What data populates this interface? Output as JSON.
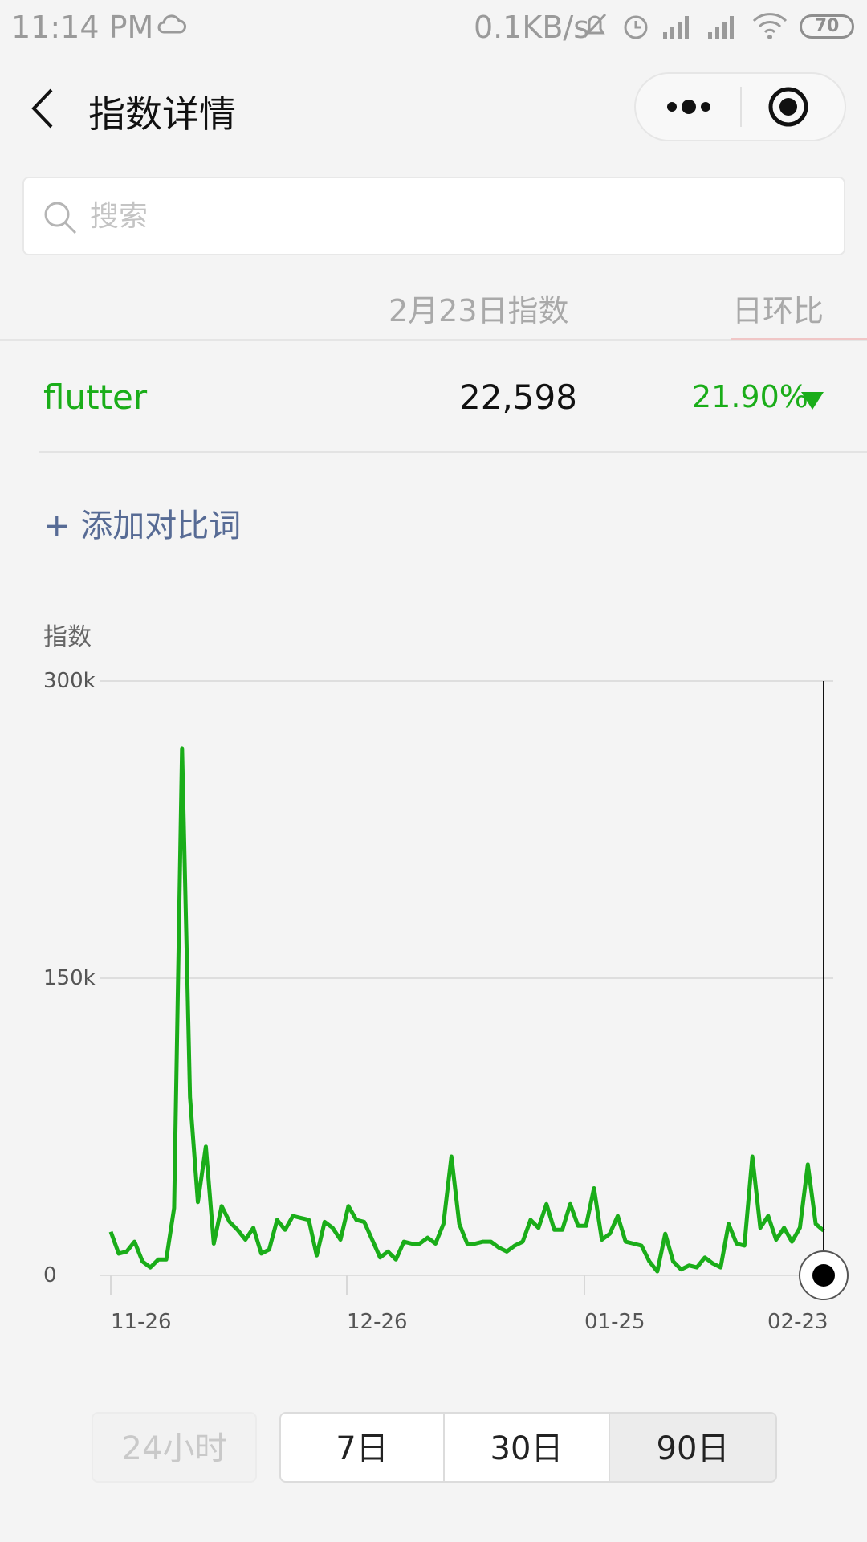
{
  "status_bar": {
    "time": "11:14 PM",
    "network_speed": "0.1KB/s",
    "battery": "70",
    "icons": [
      "cloud-icon",
      "mute-bell-icon",
      "alarm-icon",
      "signal-icon",
      "signal-icon",
      "wifi-icon",
      "battery-icon"
    ]
  },
  "header": {
    "title": "指数详情",
    "icons": [
      "back-chevron-icon",
      "more-dots-icon",
      "close-target-icon"
    ]
  },
  "search": {
    "placeholder": "搜索"
  },
  "table": {
    "col_index_header": "2月23日指数",
    "col_ratio_header": "日环比",
    "row": {
      "keyword": "flutter",
      "value": "22,598",
      "ratio": "21.90%",
      "trend": "down"
    }
  },
  "add_compare_label": "+ 添加对比词",
  "colors": {
    "accent_green": "#1aad19",
    "link_blue": "#576b95"
  },
  "chart_data": {
    "type": "line",
    "ylabel": "指数",
    "ylim": [
      0,
      300000
    ],
    "y_ticks": [
      "300k",
      "150k",
      "0"
    ],
    "x_ticks": [
      "11-26",
      "12-26",
      "01-25",
      "02-23"
    ],
    "series": [
      {
        "values": [
          22000,
          11000,
          12000,
          17000,
          7000,
          4000,
          8000,
          8000,
          34000,
          266000,
          90000,
          37000,
          65000,
          16000,
          35000,
          27000,
          23000,
          18000,
          24000,
          11000,
          13000,
          28000,
          23000,
          30000,
          29000,
          28000,
          10000,
          27000,
          24000,
          18000,
          35000,
          28000,
          27000,
          18000,
          9000,
          12000,
          8000,
          17000,
          16000,
          16000,
          19000,
          16000,
          26000,
          60000,
          26000,
          16000,
          16000,
          17000,
          17000,
          14000,
          12000,
          15000,
          17000,
          28000,
          24000,
          36000,
          23000,
          23000,
          36000,
          25000,
          25000,
          44000,
          18000,
          21000,
          30000,
          17000,
          16000,
          15000,
          7000,
          2000,
          21000,
          7000,
          3000,
          5000,
          4000,
          9000,
          6000,
          4000,
          26000,
          16000,
          15000,
          60000,
          24000,
          30000,
          18000,
          24000,
          17000,
          24000,
          56000,
          26000,
          22598
        ]
      }
    ],
    "grid": true,
    "selected_point_label": "02-23"
  },
  "range_buttons": {
    "h24": "24小时",
    "d7": "7日",
    "d30": "30日",
    "d90": "90日",
    "selected": "90日"
  }
}
